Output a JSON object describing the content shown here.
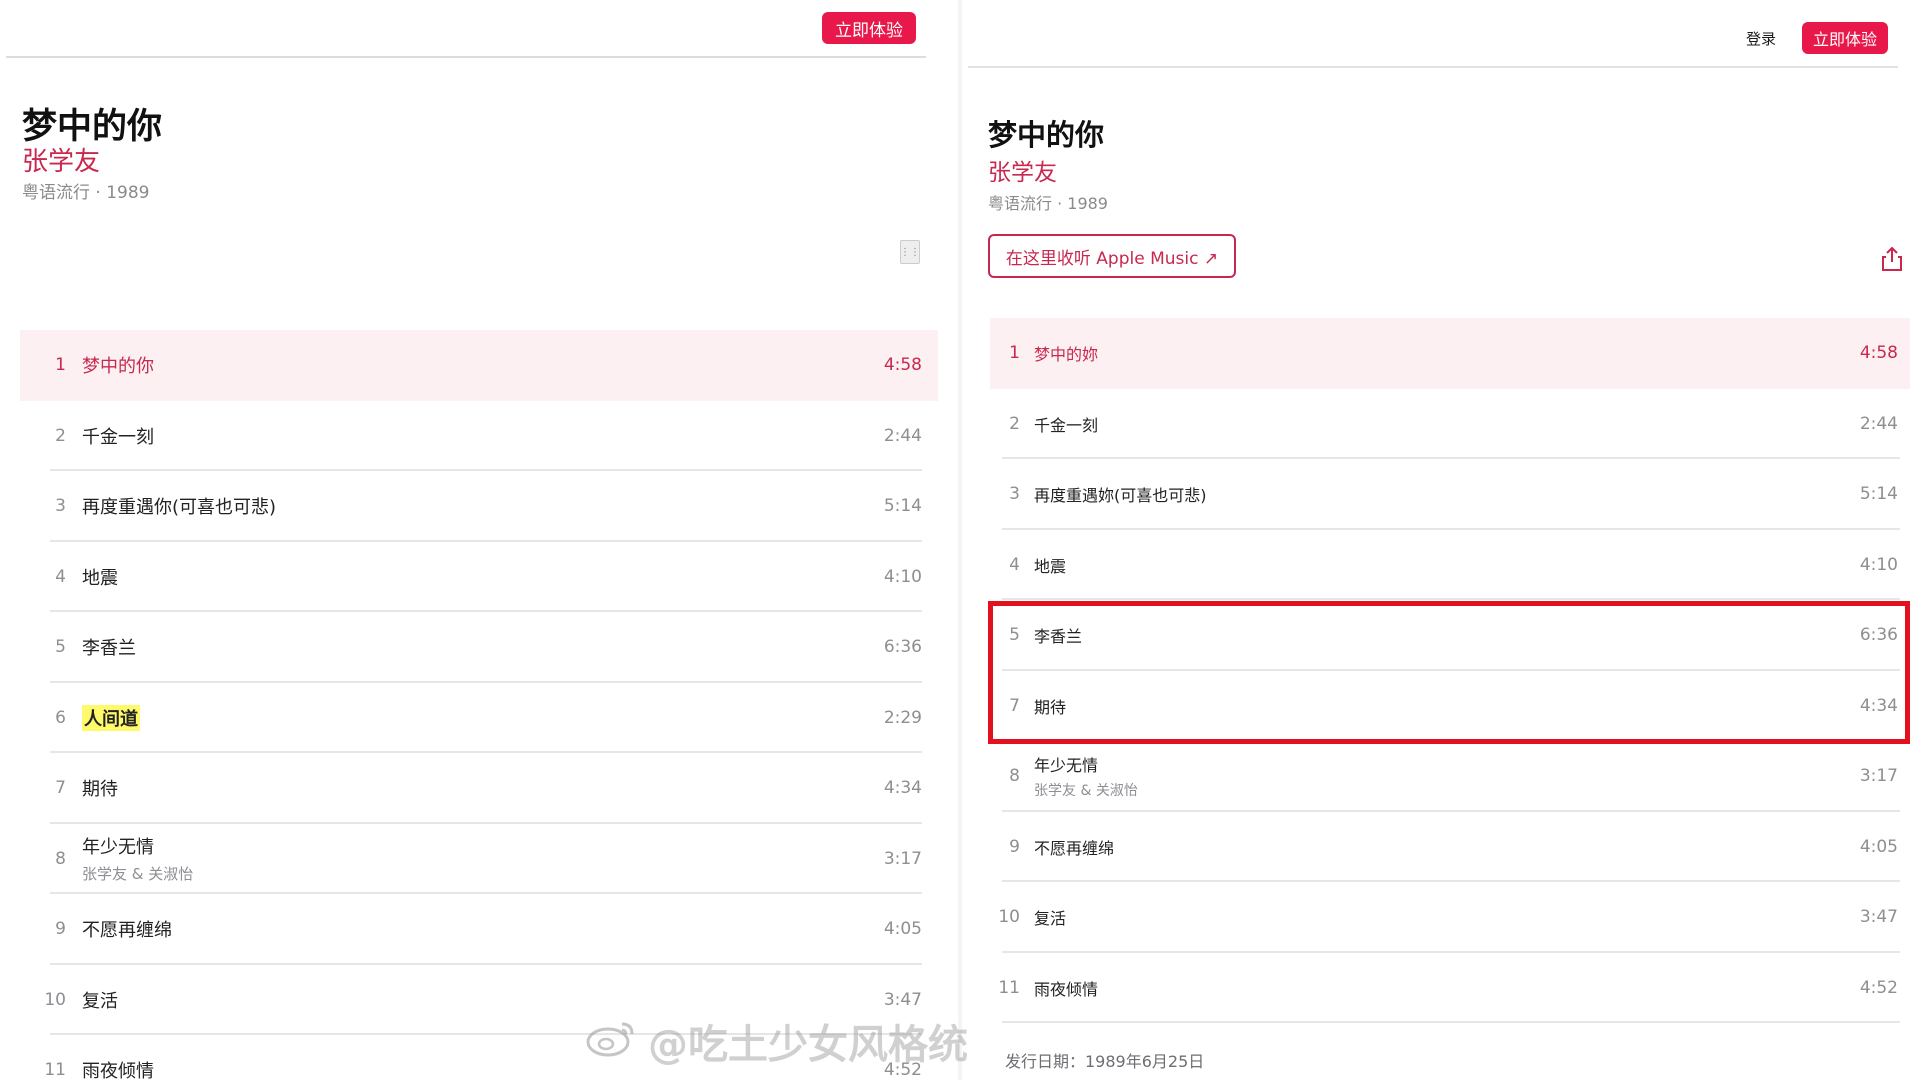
{
  "left": {
    "header": {
      "try_label": "立即体验"
    },
    "album": {
      "title": "梦中的你",
      "artist": "张学友",
      "meta": "粤语流行 · 1989"
    },
    "more_icon": "more-icon",
    "tracks": [
      {
        "num": "1",
        "name": "梦中的你",
        "duration": "4:58",
        "active": true
      },
      {
        "num": "2",
        "name": "千金一刻",
        "duration": "2:44"
      },
      {
        "num": "3",
        "name": "再度重遇你(可喜也可悲)",
        "duration": "5:14"
      },
      {
        "num": "4",
        "name": "地震",
        "duration": "4:10"
      },
      {
        "num": "5",
        "name": "李香兰",
        "duration": "6:36"
      },
      {
        "num": "6",
        "name": "人间道",
        "duration": "2:29",
        "highlighted": true
      },
      {
        "num": "7",
        "name": "期待",
        "duration": "4:34"
      },
      {
        "num": "8",
        "name": "年少无情",
        "sub": "张学友 & 关淑怡",
        "duration": "3:17"
      },
      {
        "num": "9",
        "name": "不愿再缠绵",
        "duration": "4:05"
      },
      {
        "num": "10",
        "name": "复活",
        "duration": "3:47"
      },
      {
        "num": "11",
        "name": "雨夜倾情",
        "duration": "4:52"
      }
    ]
  },
  "right": {
    "header": {
      "login_label": "登录",
      "try_label": "立即体验"
    },
    "album": {
      "title": "梦中的你",
      "artist": "张学友",
      "meta": "粤语流行 · 1989"
    },
    "listen_label": "在这里收听 Apple Music ↗",
    "share_icon": "share-icon",
    "tracks": [
      {
        "num": "1",
        "name": "梦中的妳",
        "duration": "4:58",
        "active": true
      },
      {
        "num": "2",
        "name": "千金一刻",
        "duration": "2:44"
      },
      {
        "num": "3",
        "name": "再度重遇妳(可喜也可悲)",
        "duration": "5:14"
      },
      {
        "num": "4",
        "name": "地震",
        "duration": "4:10"
      },
      {
        "num": "5",
        "name": "李香兰",
        "duration": "6:36"
      },
      {
        "num": "7",
        "name": "期待",
        "duration": "4:34"
      },
      {
        "num": "8",
        "name": "年少无情",
        "sub": "张学友 & 关淑怡",
        "duration": "3:17"
      },
      {
        "num": "9",
        "name": "不愿再缠绵",
        "duration": "4:05"
      },
      {
        "num": "10",
        "name": "复活",
        "duration": "3:47"
      },
      {
        "num": "11",
        "name": "雨夜倾情",
        "duration": "4:52"
      }
    ],
    "release_date": "发行日期：1989年6月25日"
  },
  "watermark": "@吃土少女风格统",
  "colors": {
    "accent": "#e8194a",
    "artist": "#c8284e",
    "highlight_box": "#e3101e",
    "text_highlight": "#fffa6b"
  }
}
